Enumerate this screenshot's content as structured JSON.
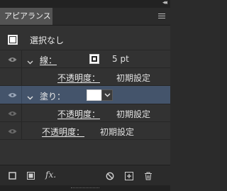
{
  "panel": {
    "title": "アピアランス",
    "collapse_glyph": "◂◂"
  },
  "rows": {
    "path": {
      "label": "選択なし"
    },
    "stroke": {
      "label": "線：",
      "weight": "5 pt"
    },
    "stroke_opacity": {
      "label": "不透明度：",
      "value": "初期設定"
    },
    "fill": {
      "label": "塗り："
    },
    "fill_opacity": {
      "label": "不透明度：",
      "value": "初期設定"
    },
    "opacity": {
      "label": "不透明度：",
      "value": "初期設定"
    }
  },
  "colors": {
    "selected_row": "#44546b",
    "fill_color": "#ffffff"
  },
  "toolbar": {
    "icons": [
      "add-new-stroke-icon",
      "add-new-fill-icon",
      "add-effect-icon",
      "clear-appearance-icon",
      "duplicate-item-icon",
      "delete-item-icon"
    ],
    "fx_label": "fx."
  }
}
